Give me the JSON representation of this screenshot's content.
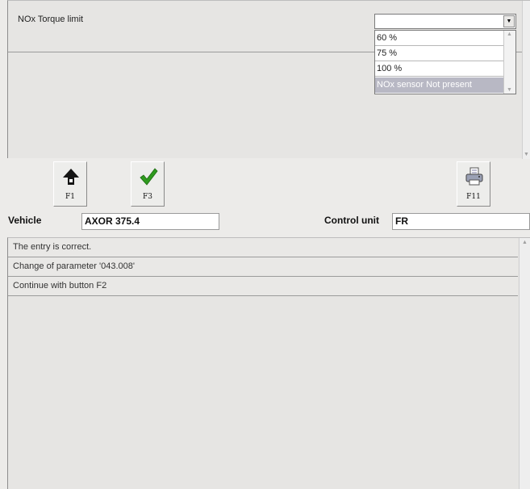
{
  "parameter": {
    "label": "NOx Torque limit",
    "selected_value": "",
    "dropdown_arrow": "▼",
    "options": [
      "60 %",
      "75 %",
      "100 %",
      "NOx sensor Not present"
    ],
    "highlighted_option": "NOx sensor Not present"
  },
  "toolbar": {
    "f1_label": "F1",
    "f3_label": "F3",
    "f11_label": "F11",
    "f1_icon": "up-arrow-icon",
    "f3_icon": "checkmark-icon",
    "f11_icon": "printer-icon"
  },
  "info": {
    "vehicle_label": "Vehicle",
    "vehicle_value": "AXOR 375.4",
    "control_unit_label": "Control unit",
    "control_unit_value": "FR"
  },
  "messages": [
    "The entry is correct.",
    "Change of parameter '043.008'",
    "Continue with button F2"
  ],
  "colors": {
    "background": "#ecebe9",
    "check_green": "#2e9a1e",
    "selection": "#b8b8c4"
  }
}
